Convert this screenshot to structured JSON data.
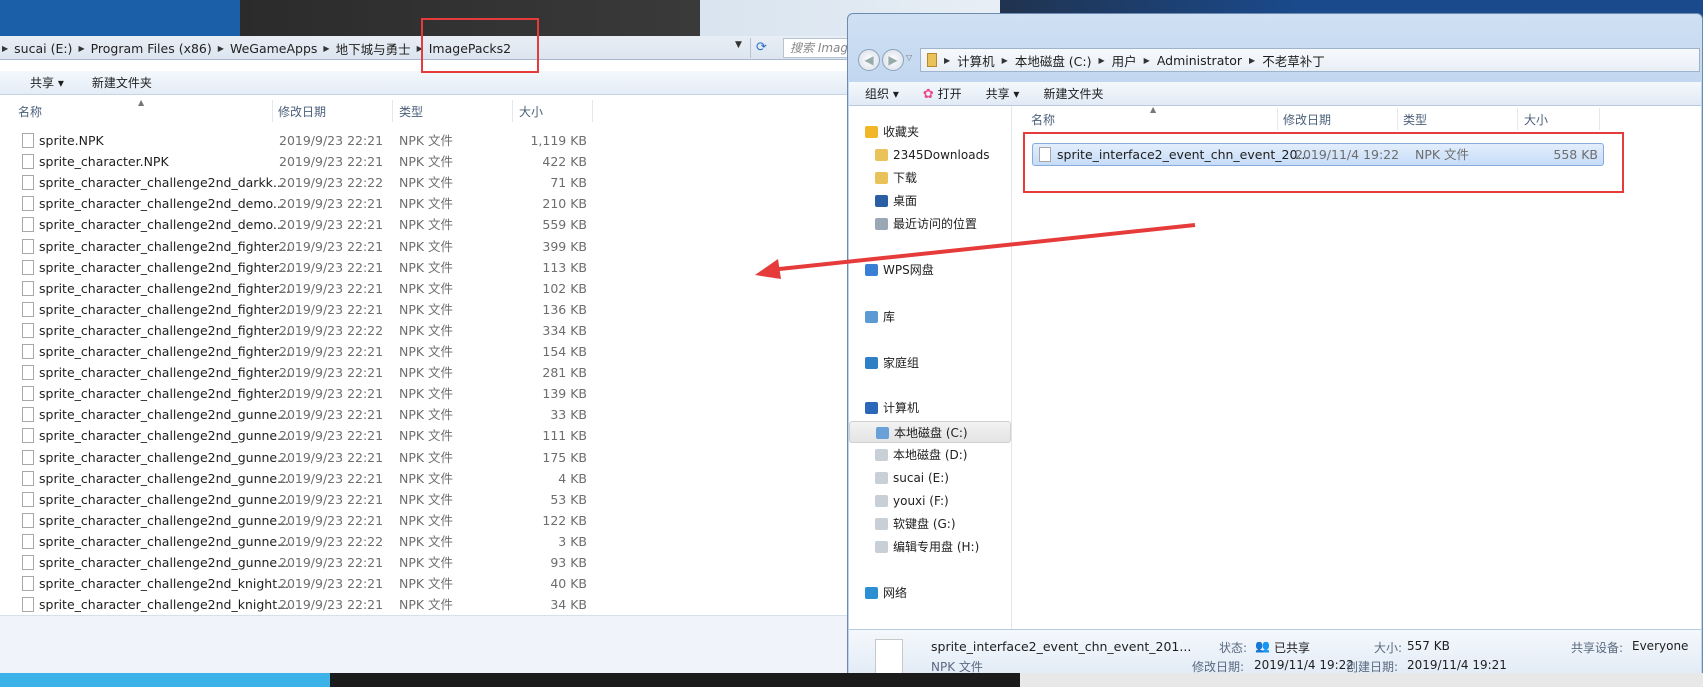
{
  "left_window": {
    "breadcrumb": [
      "sucai (E:)",
      "Program Files (x86)",
      "WeGameApps",
      "地下城与勇士",
      "ImagePacks2"
    ],
    "search_placeholder": "搜索 Imag",
    "toolbar": {
      "share": "共享 ▾",
      "new_folder": "新建文件夹"
    },
    "columns": {
      "name": "名称",
      "date": "修改日期",
      "type": "类型",
      "size": "大小"
    },
    "files": [
      {
        "name": "sprite.NPK",
        "date": "2019/9/23 22:21",
        "type": "NPK 文件",
        "size": "1,119 KB"
      },
      {
        "name": "sprite_character.NPK",
        "date": "2019/9/23 22:21",
        "type": "NPK 文件",
        "size": "422 KB"
      },
      {
        "name": "sprite_character_challenge2nd_darkk...",
        "date": "2019/9/23 22:22",
        "type": "NPK 文件",
        "size": "71 KB"
      },
      {
        "name": "sprite_character_challenge2nd_demo...",
        "date": "2019/9/23 22:21",
        "type": "NPK 文件",
        "size": "210 KB"
      },
      {
        "name": "sprite_character_challenge2nd_demo...",
        "date": "2019/9/23 22:21",
        "type": "NPK 文件",
        "size": "559 KB"
      },
      {
        "name": "sprite_character_challenge2nd_fighter...",
        "date": "2019/9/23 22:21",
        "type": "NPK 文件",
        "size": "399 KB"
      },
      {
        "name": "sprite_character_challenge2nd_fighter...",
        "date": "2019/9/23 22:21",
        "type": "NPK 文件",
        "size": "113 KB"
      },
      {
        "name": "sprite_character_challenge2nd_fighter...",
        "date": "2019/9/23 22:21",
        "type": "NPK 文件",
        "size": "102 KB"
      },
      {
        "name": "sprite_character_challenge2nd_fighter...",
        "date": "2019/9/23 22:21",
        "type": "NPK 文件",
        "size": "136 KB"
      },
      {
        "name": "sprite_character_challenge2nd_fighter...",
        "date": "2019/9/23 22:22",
        "type": "NPK 文件",
        "size": "334 KB"
      },
      {
        "name": "sprite_character_challenge2nd_fighter...",
        "date": "2019/9/23 22:21",
        "type": "NPK 文件",
        "size": "154 KB"
      },
      {
        "name": "sprite_character_challenge2nd_fighter...",
        "date": "2019/9/23 22:21",
        "type": "NPK 文件",
        "size": "281 KB"
      },
      {
        "name": "sprite_character_challenge2nd_fighter...",
        "date": "2019/9/23 22:21",
        "type": "NPK 文件",
        "size": "139 KB"
      },
      {
        "name": "sprite_character_challenge2nd_gunne...",
        "date": "2019/9/23 22:21",
        "type": "NPK 文件",
        "size": "33 KB"
      },
      {
        "name": "sprite_character_challenge2nd_gunne...",
        "date": "2019/9/23 22:21",
        "type": "NPK 文件",
        "size": "111 KB"
      },
      {
        "name": "sprite_character_challenge2nd_gunne...",
        "date": "2019/9/23 22:21",
        "type": "NPK 文件",
        "size": "175 KB"
      },
      {
        "name": "sprite_character_challenge2nd_gunne...",
        "date": "2019/9/23 22:21",
        "type": "NPK 文件",
        "size": "4 KB"
      },
      {
        "name": "sprite_character_challenge2nd_gunne...",
        "date": "2019/9/23 22:21",
        "type": "NPK 文件",
        "size": "53 KB"
      },
      {
        "name": "sprite_character_challenge2nd_gunne...",
        "date": "2019/9/23 22:21",
        "type": "NPK 文件",
        "size": "122 KB"
      },
      {
        "name": "sprite_character_challenge2nd_gunne...",
        "date": "2019/9/23 22:22",
        "type": "NPK 文件",
        "size": "3 KB"
      },
      {
        "name": "sprite_character_challenge2nd_gunne...",
        "date": "2019/9/23 22:21",
        "type": "NPK 文件",
        "size": "93 KB"
      },
      {
        "name": "sprite_character_challenge2nd_knight...",
        "date": "2019/9/23 22:21",
        "type": "NPK 文件",
        "size": "40 KB"
      },
      {
        "name": "sprite_character_challenge2nd_knight...",
        "date": "2019/9/23 22:21",
        "type": "NPK 文件",
        "size": "34 KB"
      }
    ]
  },
  "right_window": {
    "breadcrumb": [
      "计算机",
      "本地磁盘 (C:)",
      "用户",
      "Administrator",
      "不老草补丁"
    ],
    "toolbar": {
      "organize": "组织 ▾",
      "open": "打开",
      "share": "共享 ▾",
      "new_folder": "新建文件夹"
    },
    "nav": [
      {
        "label": "收藏夹",
        "icon": "star-icon",
        "color": "#f2b629",
        "indent": 0
      },
      {
        "label": "2345Downloads",
        "icon": "folder-icon",
        "color": "#e9c35a",
        "indent": 1
      },
      {
        "label": "下载",
        "icon": "downloads-folder-icon",
        "color": "#e9c35a",
        "indent": 1
      },
      {
        "label": "桌面",
        "icon": "desktop-icon",
        "color": "#2a5fa5",
        "indent": 1
      },
      {
        "label": "最近访问的位置",
        "icon": "recent-places-icon",
        "color": "#9aa7b5",
        "indent": 1
      },
      {
        "label": "WPS网盘",
        "icon": "cloud-icon",
        "color": "#3a7fd6",
        "indent": 0
      },
      {
        "label": "库",
        "icon": "library-icon",
        "color": "#5b9bd5",
        "indent": 0
      },
      {
        "label": "家庭组",
        "icon": "homegroup-icon",
        "color": "#2f7fc4",
        "indent": 0
      },
      {
        "label": "计算机",
        "icon": "computer-icon",
        "color": "#2b66b8",
        "indent": 0
      },
      {
        "label": "本地磁盘 (C:)",
        "icon": "system-drive-icon",
        "color": "#6aa0d8",
        "indent": 1,
        "selected": true
      },
      {
        "label": "本地磁盘 (D:)",
        "icon": "drive-icon",
        "color": "#c9cfd6",
        "indent": 1
      },
      {
        "label": "sucai (E:)",
        "icon": "drive-icon",
        "color": "#c9cfd6",
        "indent": 1
      },
      {
        "label": "youxi (F:)",
        "icon": "drive-icon",
        "color": "#c9cfd6",
        "indent": 1
      },
      {
        "label": "软键盘 (G:)",
        "icon": "drive-icon",
        "color": "#c9cfd6",
        "indent": 1
      },
      {
        "label": "编辑专用盘 (H:)",
        "icon": "drive-icon",
        "color": "#c9cfd6",
        "indent": 1
      },
      {
        "label": "网络",
        "icon": "network-icon",
        "color": "#2b8fd1",
        "indent": 0
      }
    ],
    "columns": {
      "name": "名称",
      "date": "修改日期",
      "type": "类型",
      "size": "大小"
    },
    "file": {
      "name": "sprite_interface2_event_chn_event_20...",
      "date": "2019/11/4 19:22",
      "type": "NPK 文件",
      "size": "558 KB"
    },
    "status": {
      "name": "sprite_interface2_event_chn_event_201...",
      "type": "NPK 文件",
      "state_label": "状态:",
      "state_value": "已共享",
      "modified_label": "修改日期:",
      "modified_value": "2019/11/4 19:22",
      "size_label": "大小:",
      "size_value": "557 KB",
      "created_label": "创建日期:",
      "created_value": "2019/11/4 19:21",
      "shared_label": "共享设备:",
      "shared_value": "Everyone"
    }
  },
  "annotation_color": "#e63b3b"
}
